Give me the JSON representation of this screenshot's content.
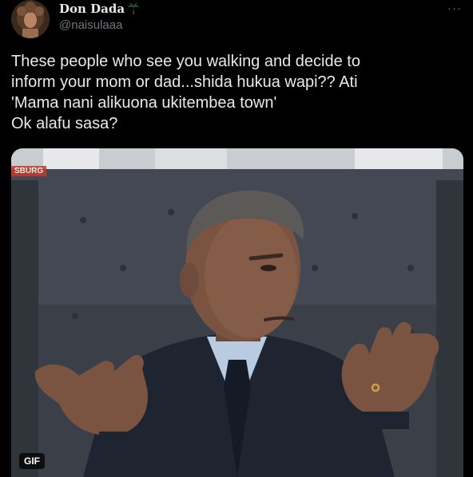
{
  "author": {
    "display_name": "Don Dada",
    "handle": "@naisulaaa",
    "name_emoji_icon": "palm-tree-icon"
  },
  "more_label": "···",
  "tweet": {
    "text": "These people who see you walking and decide to\ninform your mom or dad...shida hukua wapi?? Ati\n'Mama nani alikuona ukitembea town'\nOk alafu sasa?"
  },
  "media": {
    "badge_label": "GIF",
    "watermark_text": "SBURG"
  },
  "colors": {
    "background": "#000000",
    "text": "#e7e9ea",
    "secondary_text": "#71767b"
  }
}
